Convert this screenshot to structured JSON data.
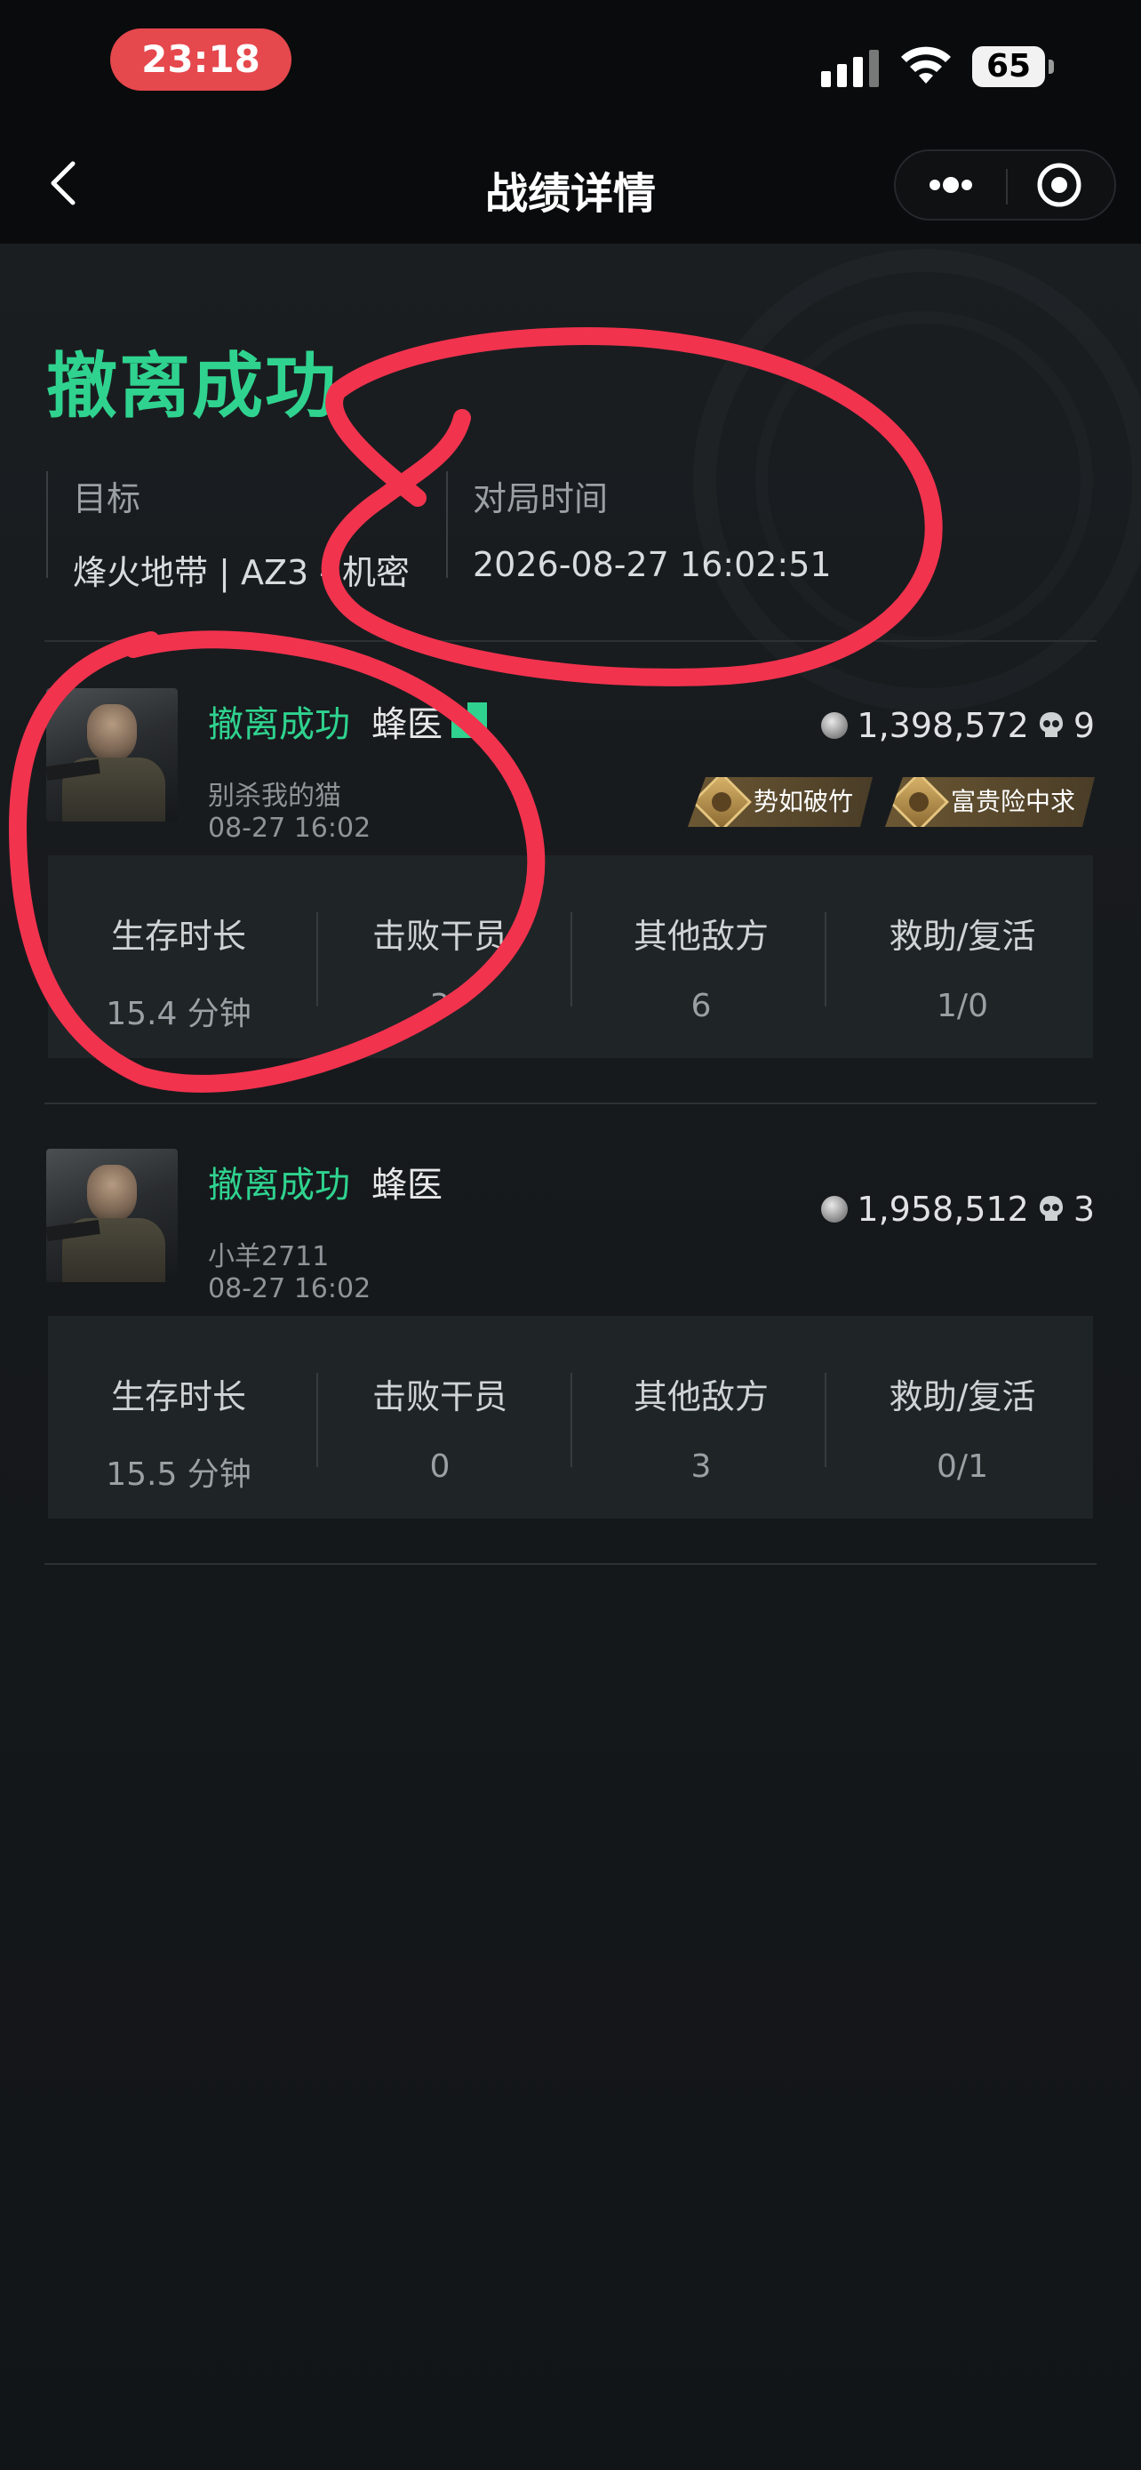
{
  "status_bar": {
    "time": "23:18",
    "battery": "65"
  },
  "nav": {
    "title": "战绩详情"
  },
  "header": {
    "result": "撤离成功",
    "target_label": "目标",
    "target_value": "烽火地带 | AZ3 - 机密",
    "time_label": "对局时间",
    "time_value": "2026-08-27 16:02:51"
  },
  "players": [
    {
      "status": "撤离成功",
      "role": "蜂医",
      "name": "别杀我的猫",
      "time": "08-27 16:02",
      "assets": "1,398,572",
      "kills_icon_value": "9",
      "badges": [
        "势如破竹",
        "富贵险中求"
      ],
      "stats": [
        {
          "label": "生存时长",
          "value": "15.4 分钟"
        },
        {
          "label": "击败干员",
          "value": "3"
        },
        {
          "label": "其他敌方",
          "value": "6"
        },
        {
          "label": "救助/复活",
          "value": "1/0"
        }
      ]
    },
    {
      "status": "撤离成功",
      "role": "蜂医",
      "name": "小羊2711",
      "time": "08-27 16:02",
      "assets": "1,958,512",
      "kills_icon_value": "3",
      "badges": [],
      "stats": [
        {
          "label": "生存时长",
          "value": "15.5 分钟"
        },
        {
          "label": "击败干员",
          "value": "0"
        },
        {
          "label": "其他敌方",
          "value": "3"
        },
        {
          "label": "救助/复活",
          "value": "0/1"
        }
      ]
    }
  ],
  "colors": {
    "accent_green": "#2fd38f",
    "annotation_red": "#f2334e",
    "time_pill": "#e5484d"
  },
  "icons": [
    "back-chevron-icon",
    "more-dots-icon",
    "target-close-icon",
    "coin-icon",
    "skull-icon",
    "medal-icon"
  ]
}
